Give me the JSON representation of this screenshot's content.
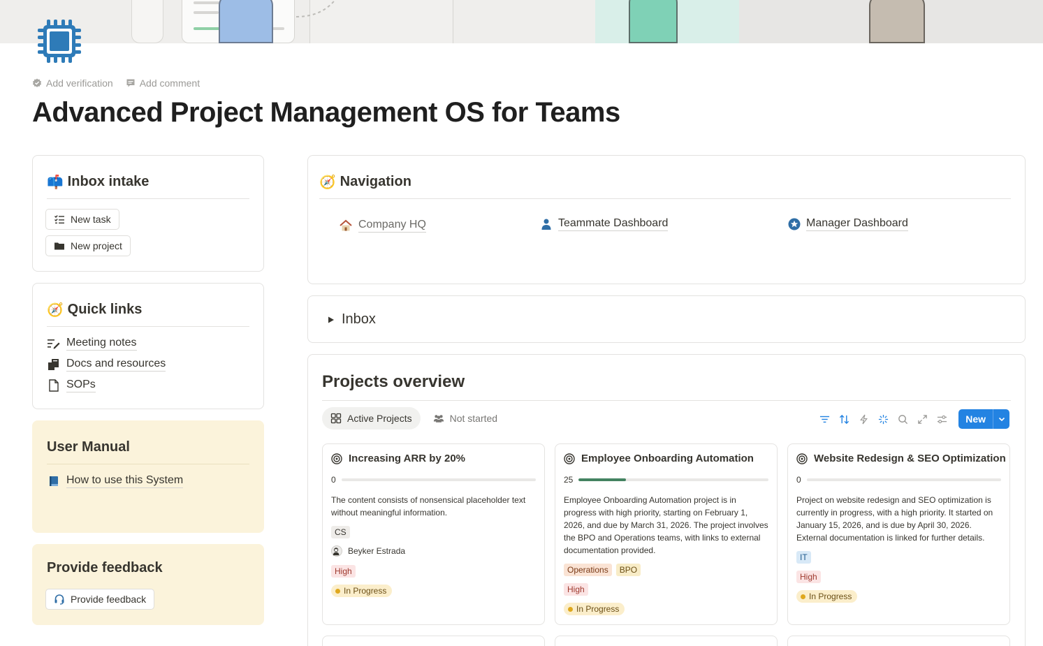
{
  "page": {
    "title": "Advanced Project Management OS for Teams",
    "meta": {
      "verification": "Add verification",
      "comment": "Add comment"
    },
    "icon": "cpu-chip-icon"
  },
  "inbox_intake": {
    "emoji": "📫",
    "title": "Inbox intake",
    "buttons": [
      {
        "label": "New task",
        "icon": "task-list-icon"
      },
      {
        "label": "New project",
        "icon": "folder-icon"
      }
    ]
  },
  "quick_links": {
    "emoji": "🧭",
    "title": "Quick links",
    "items": [
      {
        "label": "Meeting notes",
        "icon": "notes-pen-icon"
      },
      {
        "label": "Docs and resources",
        "icon": "documents-icon"
      },
      {
        "label": "SOPs",
        "icon": "page-icon"
      }
    ]
  },
  "user_manual": {
    "title": "User Manual",
    "link": {
      "label": "How to use this System",
      "icon": "book-icon"
    }
  },
  "feedback": {
    "title": "Provide feedback",
    "button": {
      "label": "Provide feedback",
      "icon": "headset-icon"
    }
  },
  "navigation": {
    "emoji": "🧭",
    "title": "Navigation",
    "links": [
      {
        "label": "Company HQ",
        "icon": "house-emoji"
      },
      {
        "label": "Teammate Dashboard",
        "icon": "person-icon"
      },
      {
        "label": "Manager Dashboard",
        "icon": "star-badge-icon"
      }
    ]
  },
  "inbox_toggle": {
    "label": "Inbox",
    "icon": "triangle-right-icon"
  },
  "projects": {
    "title": "Projects overview",
    "tabs": [
      {
        "label": "Active Projects",
        "icon": "gallery-icon",
        "active": true
      },
      {
        "label": "Not started",
        "icon": "people-icon",
        "active": false
      }
    ],
    "tools": [
      "filter-icon",
      "sort-icon",
      "automation-icon",
      "ai-sparkle-icon",
      "search-icon",
      "expand-icon",
      "settings-sliders-icon"
    ],
    "new_button": "New",
    "accent": "#2383e2",
    "cards": [
      {
        "title": "Increasing ARR by 20%",
        "progress": 0,
        "progress_label": "0",
        "description": "The content consists of nonsensical placeholder text without meaningful information.",
        "teams": [
          {
            "label": "CS",
            "color": "gray"
          }
        ],
        "owner": "Beyker Estrada",
        "priority": "High",
        "status": "In Progress"
      },
      {
        "title": "Employee Onboarding Automation",
        "progress": 25,
        "progress_label": "25",
        "description": "Employee Onboarding Automation project is in progress with high priority, starting on February 1, 2026, and due by March 31, 2026. The project involves the BPO and Operations teams, with links to external documentation provided.",
        "teams": [
          {
            "label": "Operations",
            "color": "orange"
          },
          {
            "label": "BPO",
            "color": "yellow"
          }
        ],
        "owner": "",
        "priority": "High",
        "status": "In Progress"
      },
      {
        "title": "Website Redesign & SEO Optimization",
        "progress": 0,
        "progress_label": "0",
        "description": "Project on website redesign and SEO optimization is currently in progress, with a high priority. It started on January 15, 2026, and is due by April 30, 2026. External documentation is linked for further details.",
        "teams": [
          {
            "label": "IT",
            "color": "blue"
          }
        ],
        "owner": "",
        "priority": "High",
        "status": "In Progress"
      }
    ]
  }
}
